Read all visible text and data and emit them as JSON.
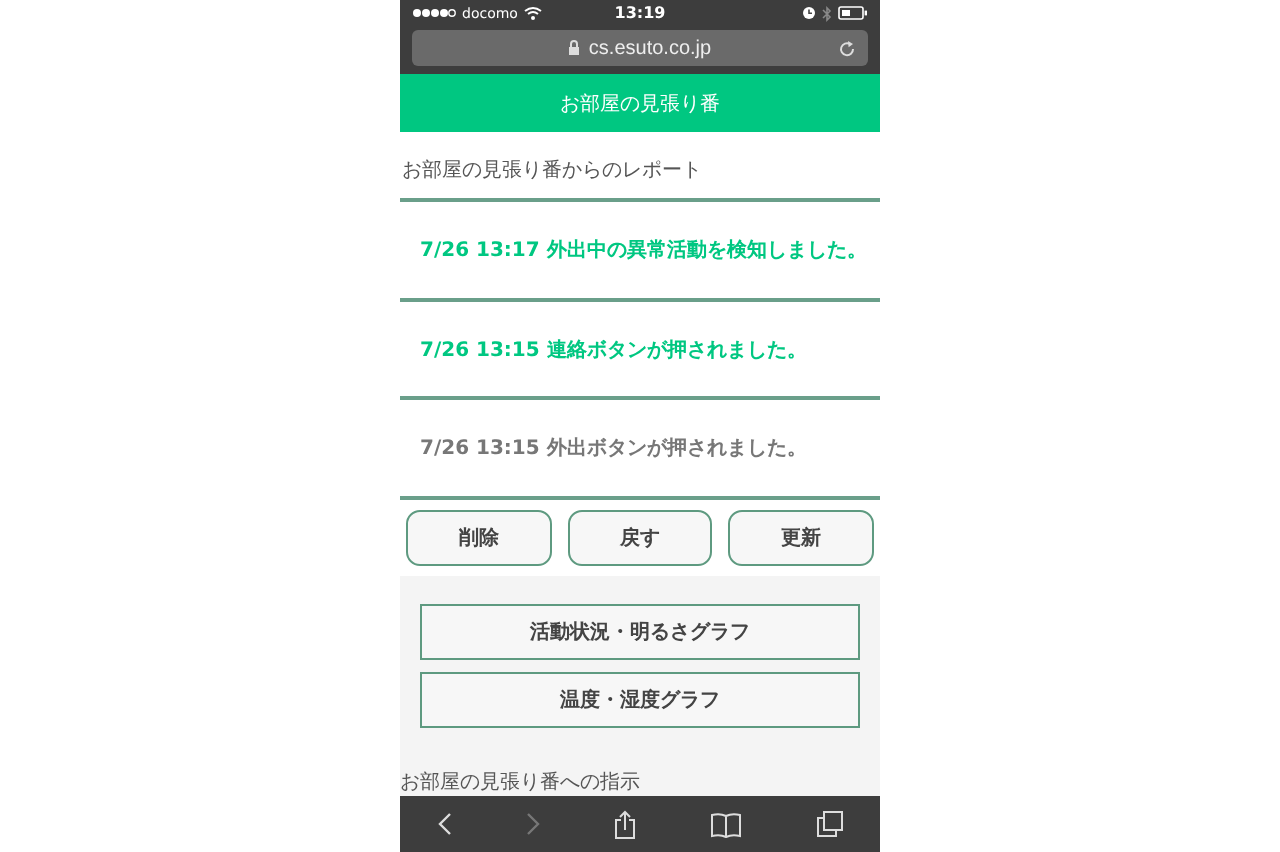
{
  "status_bar": {
    "carrier": "docomo",
    "time": "13:19"
  },
  "address_bar": {
    "url": "cs.esuto.co.jp"
  },
  "header": {
    "title": "お部屋の見張り番"
  },
  "report": {
    "title": "お部屋の見張り番からのレポート",
    "items": [
      {
        "text": "7/26 13:17 外出中の異常活動を検知しました。",
        "alert": true
      },
      {
        "text": "7/26 13:15 連絡ボタンが押されました。",
        "alert": true
      },
      {
        "text": "7/26 13:15 外出ボタンが押されました。",
        "alert": false
      }
    ]
  },
  "actions": [
    "削除",
    "戻す",
    "更新"
  ],
  "graph_links": [
    "活動状況・明るさグラフ",
    "温度・湿度グラフ"
  ],
  "next_section": {
    "title": "お部屋の見張り番への指示"
  },
  "toolbar": {
    "back_disabled": false,
    "forward_disabled": true
  }
}
